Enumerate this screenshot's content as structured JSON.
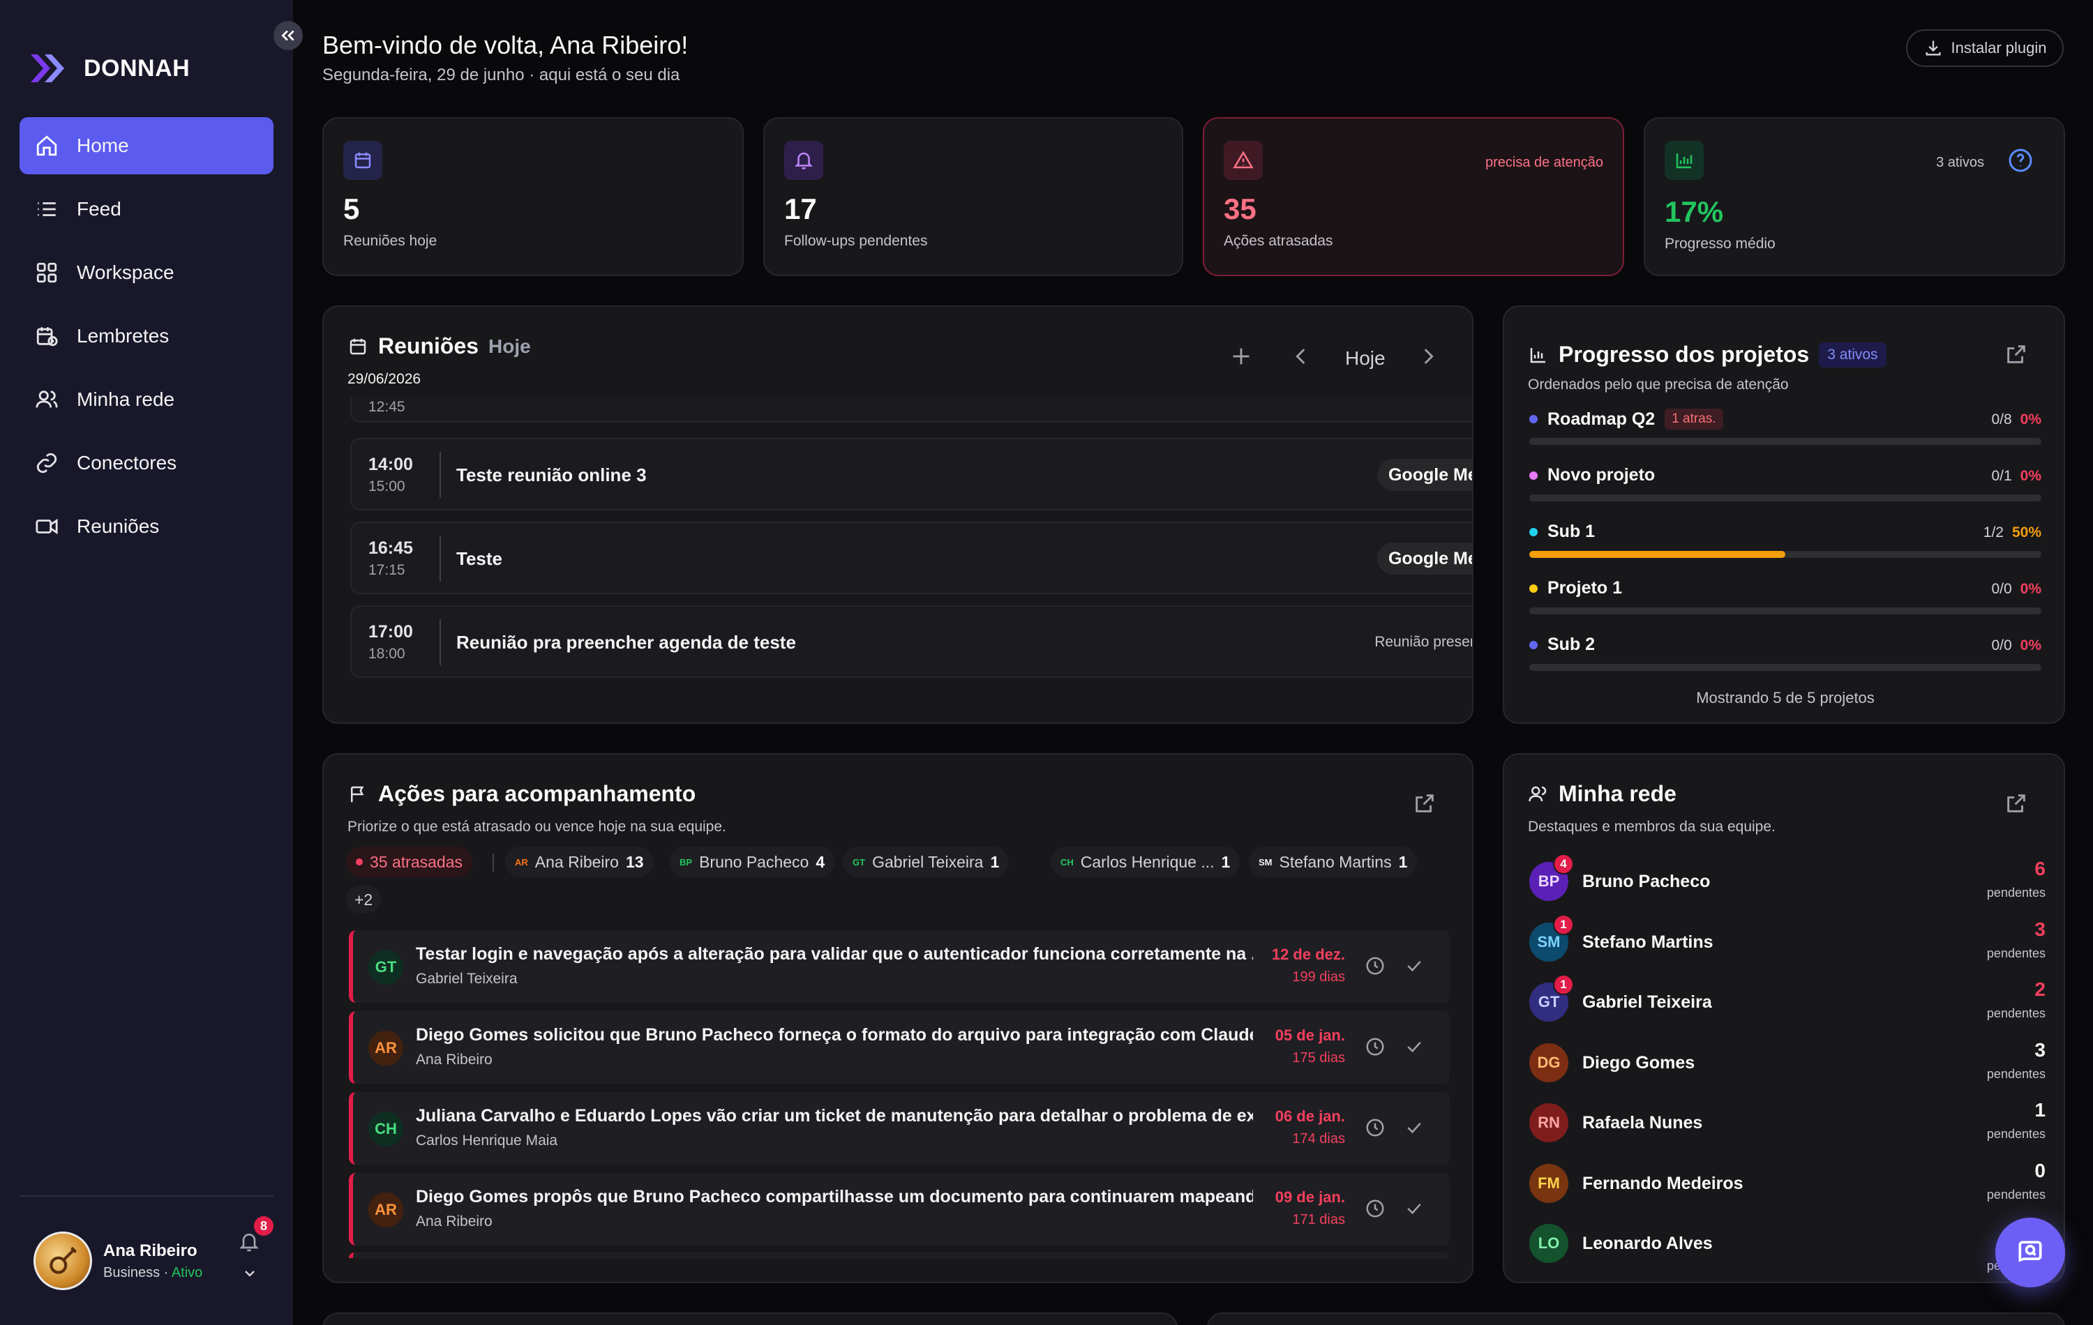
{
  "brand": {
    "name": "DONNAH"
  },
  "sidebar": {
    "items": [
      {
        "label": "Home",
        "icon": "home-icon",
        "active": true
      },
      {
        "label": "Feed",
        "icon": "list-icon"
      },
      {
        "label": "Workspace",
        "icon": "grid-icon"
      },
      {
        "label": "Lembretes",
        "icon": "calendar-clock-icon"
      },
      {
        "label": "Minha rede",
        "icon": "users-icon"
      },
      {
        "label": "Conectores",
        "icon": "link-icon"
      },
      {
        "label": "Reuniões",
        "icon": "video-icon"
      }
    ],
    "user": {
      "name": "Ana Ribeiro",
      "plan": "Business",
      "status": "Ativo",
      "notifications": "8"
    }
  },
  "header": {
    "title": "Bem-vindo de volta, Ana Ribeiro!",
    "subtitle": "Segunda-feira, 29 de junho · aqui está o seu dia",
    "plugin_button": "Instalar plugin"
  },
  "stats": [
    {
      "value": "5",
      "label": "Reuniões hoje",
      "icon": "calendar-icon",
      "color": "#8b8bff"
    },
    {
      "value": "17",
      "label": "Follow-ups pendentes",
      "icon": "bell-icon",
      "color": "#c084fc"
    },
    {
      "value": "35",
      "label": "Ações atrasadas",
      "icon": "alert-triangle-icon",
      "color": "#fb7185",
      "note": "precisa de atenção"
    },
    {
      "value": "17%",
      "label": "Progresso médio",
      "icon": "bar-chart-icon",
      "color": "#22c55e",
      "note": "3 ativos"
    }
  ],
  "meetings": {
    "title": "Reuniões",
    "filter": "Hoje",
    "date": "29/06/2026",
    "nav_today": "Hoje",
    "clipped_time": "12:45",
    "rows": [
      {
        "start": "14:00",
        "end": "15:00",
        "title": "Teste reunião online 3",
        "tag": "Google Meet"
      },
      {
        "start": "16:45",
        "end": "17:15",
        "title": "Teste",
        "tag": "Google Meet"
      },
      {
        "start": "17:00",
        "end": "18:00",
        "title": "Reunião pra preencher agenda de teste",
        "tag": "Reunião presencial"
      }
    ]
  },
  "projects": {
    "title": "Progresso dos projetos",
    "badge": "3 ativos",
    "subtitle": "Ordenados pelo que precisa de atenção",
    "footer": "Mostrando 5 de 5 projetos",
    "items": [
      {
        "name": "Roadmap Q2",
        "late": "1 atras.",
        "count": "0/8",
        "pct": "0%",
        "progress": 0,
        "color": "#6366f1"
      },
      {
        "name": "Novo projeto",
        "count": "0/1",
        "pct": "0%",
        "progress": 0,
        "color": "#e879f9"
      },
      {
        "name": "Sub 1",
        "count": "1/2",
        "pct": "50%",
        "progress": 0.5,
        "color": "#22d3ee"
      },
      {
        "name": "Projeto 1",
        "count": "0/0",
        "pct": "0%",
        "progress": 0,
        "color": "#facc15"
      },
      {
        "name": "Sub 2",
        "count": "0/0",
        "pct": "0%",
        "progress": 0,
        "color": "#6366f1"
      }
    ]
  },
  "actions": {
    "title": "Ações para acompanhamento",
    "subtitle": "Priorize o que está atrasado ou vence hoje na sua equipe.",
    "overdue_chip": "35 atrasadas",
    "more_chip": "+2",
    "people_chips": [
      {
        "ini": "AR",
        "name": "Ana Ribeiro",
        "count": "13",
        "color": "#f97316"
      },
      {
        "ini": "BP",
        "name": "Bruno Pacheco",
        "count": "4",
        "color": "#22c55e"
      },
      {
        "ini": "GT",
        "name": "Gabriel Teixeira",
        "count": "1",
        "color": "#22c55e"
      },
      {
        "ini": "CH",
        "name": "Carlos Henrique ...",
        "count": "1",
        "color": "#22c55e"
      },
      {
        "ini": "SM",
        "name": "Stefano Martins",
        "count": "1",
        "color": "#f4f4f5"
      }
    ],
    "rows": [
      {
        "ini": "GT",
        "title": "Testar login e navegação após a alteração para validar que o autenticador funciona corretamente na ...",
        "owner": "Gabriel Teixeira",
        "date": "12 de dez.",
        "days": "199 dias",
        "bg": "#0f2e22",
        "fg": "#4ade80"
      },
      {
        "ini": "AR",
        "title": "Diego Gomes solicitou que Bruno Pacheco forneça o formato do arquivo para integração com Claude...",
        "owner": "Ana Ribeiro",
        "date": "05 de jan.",
        "days": "175 dias",
        "bg": "#43210f",
        "fg": "#fb923c"
      },
      {
        "ini": "CH",
        "title": "Juliana Carvalho e Eduardo Lopes vão criar um ticket de manutenção para detalhar o problema de ex...",
        "owner": "Carlos Henrique Maia",
        "date": "06 de jan.",
        "days": "174 dias",
        "bg": "#0f2e22",
        "fg": "#4ade80"
      },
      {
        "ini": "AR",
        "title": "Diego Gomes propôs que Bruno Pacheco compartilhasse um documento para continuarem mapeand...",
        "owner": "Ana Ribeiro",
        "date": "09 de jan.",
        "days": "171 dias",
        "bg": "#43210f",
        "fg": "#fb923c"
      }
    ]
  },
  "network": {
    "title": "Minha rede",
    "subtitle": "Destaques e membros da sua equipe.",
    "pending_label": "pendentes",
    "members": [
      {
        "ini": "BP",
        "name": "Bruno Pacheco",
        "badge": "4",
        "count": "6",
        "bg": "#5b21b6",
        "fg": "#e9d5ff",
        "countColor": "#f43f5e"
      },
      {
        "ini": "SM",
        "name": "Stefano Martins",
        "badge": "1",
        "count": "3",
        "bg": "#0c4a6e",
        "fg": "#7dd3fc",
        "countColor": "#f43f5e"
      },
      {
        "ini": "GT",
        "name": "Gabriel Teixeira",
        "badge": "1",
        "count": "2",
        "bg": "#312e81",
        "fg": "#c7d2fe",
        "countColor": "#f43f5e"
      },
      {
        "ini": "DG",
        "name": "Diego Gomes",
        "count": "3",
        "bg": "#7c2d12",
        "fg": "#fdba74",
        "countColor": "#f4f4f5"
      },
      {
        "ini": "RN",
        "name": "Rafaela Nunes",
        "count": "1",
        "bg": "#7f1d1d",
        "fg": "#fca5a5",
        "countColor": "#f4f4f5"
      },
      {
        "ini": "FM",
        "name": "Fernando Medeiros",
        "count": "0",
        "bg": "#78350f",
        "fg": "#fcd34d",
        "countColor": "#f4f4f5"
      },
      {
        "ini": "LO",
        "name": "Leonardo Alves",
        "bg": "#14532d",
        "fg": "#86efac"
      }
    ]
  }
}
